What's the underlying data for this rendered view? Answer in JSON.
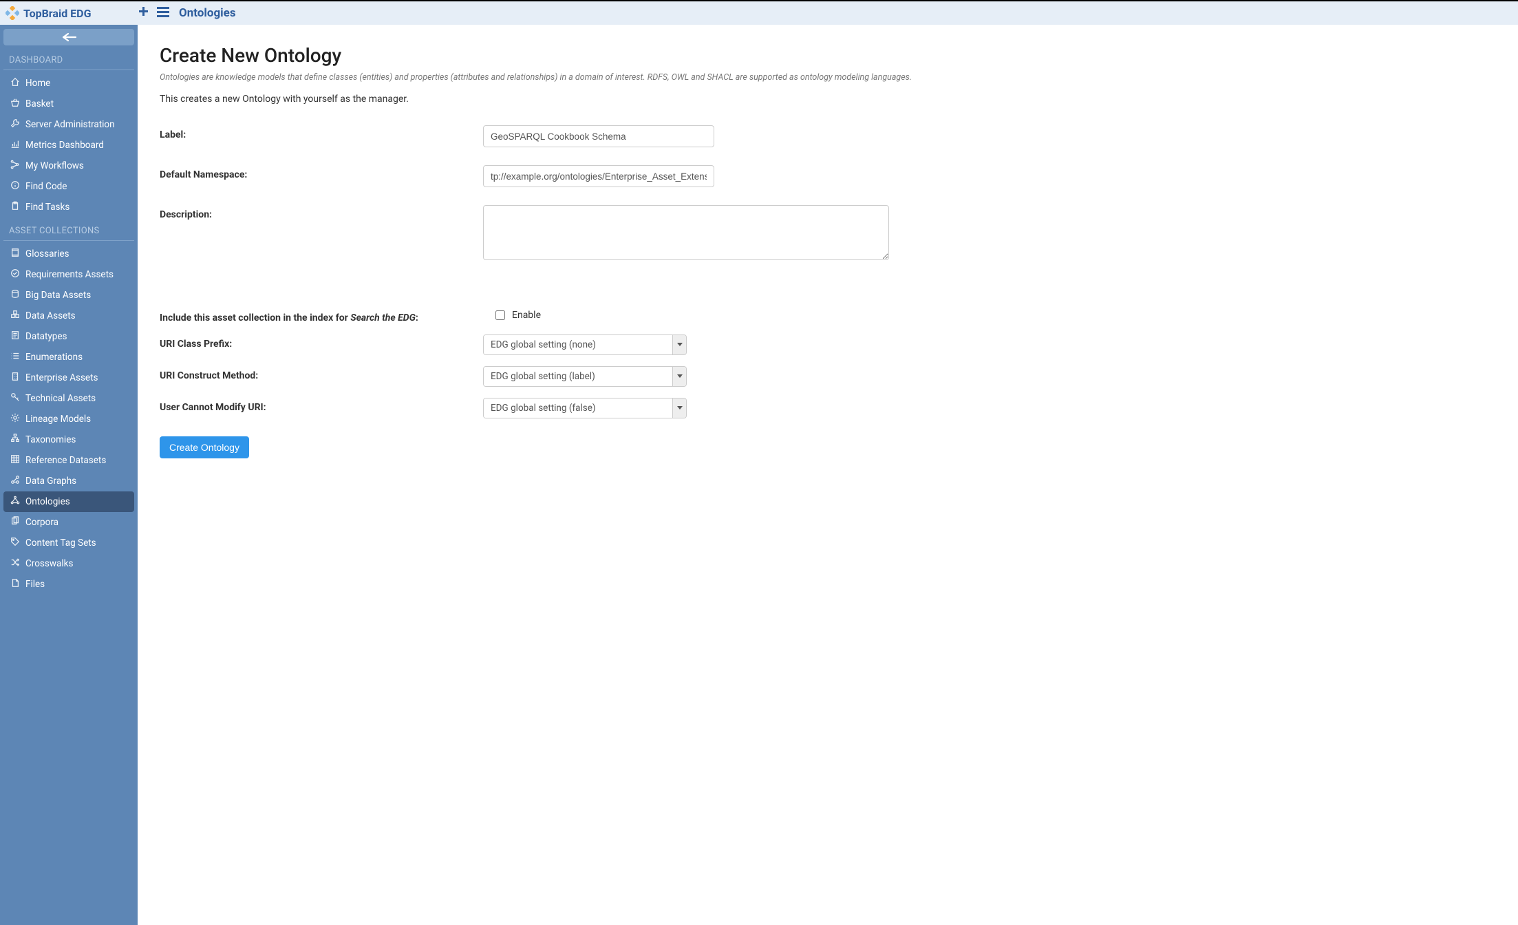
{
  "app": {
    "name": "TopBraid EDG"
  },
  "topbar": {
    "breadcrumb": "Ontologies"
  },
  "sidebar": {
    "section1_heading": "DASHBOARD",
    "section1_items": [
      {
        "icon": "home",
        "label": "Home"
      },
      {
        "icon": "basket",
        "label": "Basket"
      },
      {
        "icon": "wrench",
        "label": "Server Administration"
      },
      {
        "icon": "chart",
        "label": "Metrics Dashboard"
      },
      {
        "icon": "flow",
        "label": "My Workflows"
      },
      {
        "icon": "info",
        "label": "Find Code"
      },
      {
        "icon": "clipboard",
        "label": "Find Tasks"
      }
    ],
    "section2_heading": "ASSET COLLECTIONS",
    "section2_items": [
      {
        "icon": "book",
        "label": "Glossaries",
        "active": false
      },
      {
        "icon": "check",
        "label": "Requirements Assets",
        "active": false
      },
      {
        "icon": "db",
        "label": "Big Data Assets",
        "active": false
      },
      {
        "icon": "cubes",
        "label": "Data Assets",
        "active": false
      },
      {
        "icon": "doc",
        "label": "Datatypes",
        "active": false
      },
      {
        "icon": "list",
        "label": "Enumerations",
        "active": false
      },
      {
        "icon": "building",
        "label": "Enterprise Assets",
        "active": false
      },
      {
        "icon": "key",
        "label": "Technical Assets",
        "active": false
      },
      {
        "icon": "gear",
        "label": "Lineage Models",
        "active": false
      },
      {
        "icon": "tree",
        "label": "Taxonomies",
        "active": false
      },
      {
        "icon": "grid",
        "label": "Reference Datasets",
        "active": false
      },
      {
        "icon": "graph",
        "label": "Data Graphs",
        "active": false
      },
      {
        "icon": "ontology",
        "label": "Ontologies",
        "active": true
      },
      {
        "icon": "corpus",
        "label": "Corpora",
        "active": false
      },
      {
        "icon": "tags",
        "label": "Content Tag Sets",
        "active": false
      },
      {
        "icon": "shuffle",
        "label": "Crosswalks",
        "active": false
      },
      {
        "icon": "file",
        "label": "Files",
        "active": false
      }
    ]
  },
  "page": {
    "title": "Create New Ontology",
    "help": "Ontologies are knowledge models that define classes (entities) and properties (attributes and relationships) in a domain of interest. RDFS, OWL and SHACL are supported as ontology modeling languages.",
    "intro": "This creates a new Ontology with yourself as the manager."
  },
  "form": {
    "label_label": "Label:",
    "label_value": "GeoSPARQL Cookbook Schema",
    "namespace_label": "Default Namespace:",
    "namespace_value": "tp://example.org/ontologies/Enterprise_Asset_Extension#",
    "description_label": "Description:",
    "description_value": "",
    "index_label_prefix": "Include this asset collection in the index for ",
    "index_label_em": "Search the EDG",
    "index_label_suffix": ":",
    "index_enable_label": "Enable",
    "uri_class_prefix_label": "URI Class Prefix:",
    "uri_class_prefix_value": "EDG global setting (none)",
    "uri_construct_label": "URI Construct Method:",
    "uri_construct_value": "EDG global setting (label)",
    "user_modify_label": "User Cannot Modify URI:",
    "user_modify_value": "EDG global setting (false)",
    "submit_label": "Create Ontology"
  }
}
